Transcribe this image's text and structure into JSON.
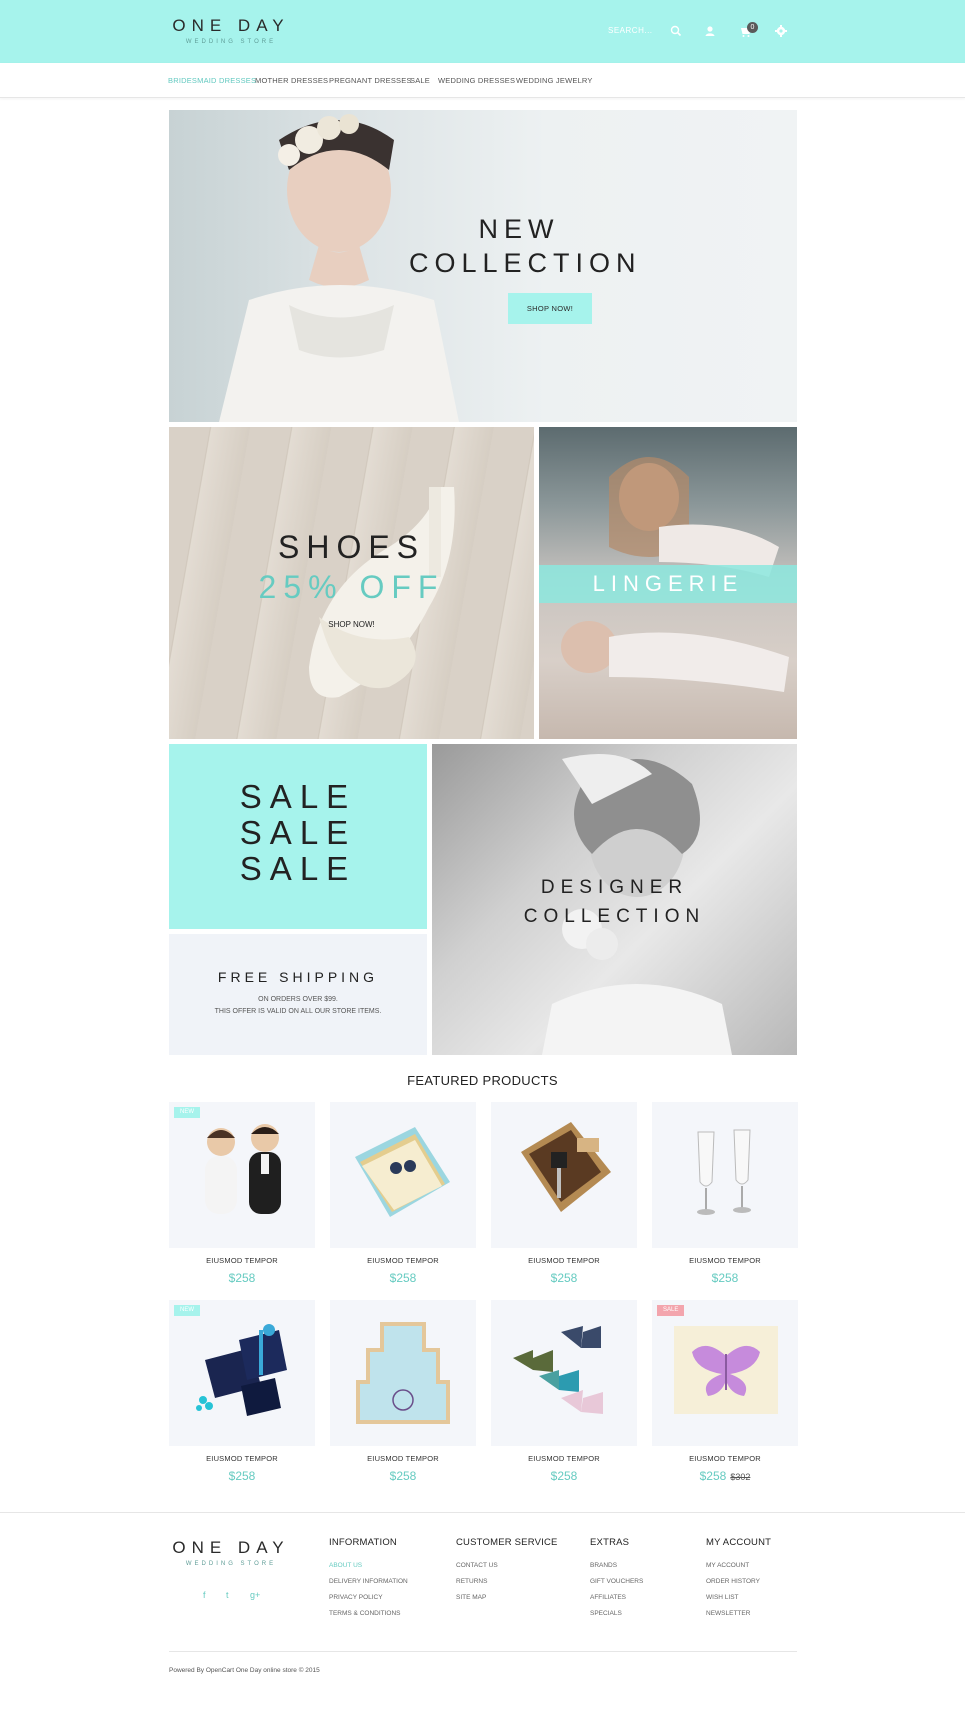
{
  "header": {
    "logo_main": "ONE DAY",
    "logo_sub": "WEDDING STORE",
    "search_placeholder": "SEARCH...",
    "cart_count": "0",
    "accent_color": "#a6f3ec"
  },
  "nav": {
    "items": [
      {
        "label": "BRIDESMAID DRESSES",
        "active": true
      },
      {
        "label": "MOTHER DRESSES"
      },
      {
        "label": "PREGNANT DRESSES"
      },
      {
        "label": "SALE"
      },
      {
        "label": "WEDDING DRESSES"
      },
      {
        "label": "WEDDING JEWELRY"
      }
    ]
  },
  "banners": {
    "hero": {
      "line1": "NEW",
      "line2": "COLLECTION",
      "button": "SHOP NOW!"
    },
    "shoes": {
      "title": "SHOES",
      "subtitle": "25% OFF",
      "button": "SHOP NOW!"
    },
    "lingerie": {
      "title": "LINGERIE"
    },
    "sale": {
      "lines": [
        "SALE",
        "SALE",
        "SALE"
      ]
    },
    "shipping": {
      "title": "FREE SHIPPING",
      "line1": "ON ORDERS OVER $99.",
      "line2": "THIS OFFER IS VALID ON ALL OUR STORE ITEMS."
    },
    "designer": {
      "line1": "DESIGNER",
      "line2": "COLLECTION"
    }
  },
  "featured": {
    "title": "FEATURED PRODUCTS",
    "products": [
      {
        "name": "EIUSMOD TEMPOR",
        "price": "$258",
        "badge": "NEW",
        "image": "wedding-figurines"
      },
      {
        "name": "EIUSMOD TEMPOR",
        "price": "$258",
        "image": "napkins"
      },
      {
        "name": "EIUSMOD TEMPOR",
        "price": "$258",
        "image": "bottle-stopper"
      },
      {
        "name": "EIUSMOD TEMPOR",
        "price": "$258",
        "image": "champagne-flutes"
      },
      {
        "name": "EIUSMOD TEMPOR",
        "price": "$258",
        "badge": "NEW",
        "image": "gift-boxes"
      },
      {
        "name": "EIUSMOD TEMPOR",
        "price": "$258",
        "image": "cake-cookie"
      },
      {
        "name": "EIUSMOD TEMPOR",
        "price": "$258",
        "image": "bow-ties"
      },
      {
        "name": "EIUSMOD TEMPOR",
        "price": "$258",
        "old_price": "$302",
        "badge": "SALE",
        "image": "butterfly-card"
      }
    ]
  },
  "footer": {
    "logo_main": "ONE DAY",
    "logo_sub": "WEDDING STORE",
    "social": [
      "f",
      "t",
      "g+"
    ],
    "columns": [
      {
        "title": "INFORMATION",
        "links": [
          "ABOUT US",
          "DELIVERY INFORMATION",
          "PRIVACY POLICY",
          "TERMS & CONDITIONS"
        ]
      },
      {
        "title": "CUSTOMER SERVICE",
        "links": [
          "CONTACT US",
          "RETURNS",
          "SITE MAP"
        ]
      },
      {
        "title": "EXTRAS",
        "links": [
          "BRANDS",
          "GIFT VOUCHERS",
          "AFFILIATES",
          "SPECIALS"
        ]
      },
      {
        "title": "MY ACCOUNT",
        "links": [
          "MY ACCOUNT",
          "ORDER HISTORY",
          "WISH LIST",
          "NEWSLETTER"
        ]
      }
    ],
    "copyright": "Powered By OpenCart One Day online store © 2015"
  }
}
